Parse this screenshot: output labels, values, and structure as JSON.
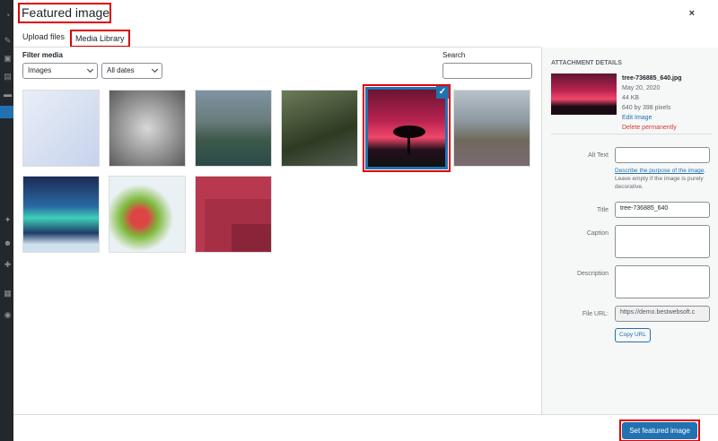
{
  "modal": {
    "title": "Featured image",
    "close_label": "×"
  },
  "tabs": [
    {
      "label": "Upload files"
    },
    {
      "label": "Media Library"
    }
  ],
  "filters": {
    "filter_label": "Filter media",
    "type_select": "Images",
    "date_select": "All dates",
    "search_label": "Search",
    "search_value": ""
  },
  "attachment": {
    "heading": "ATTACHMENT DETAILS",
    "filename": "tree-736885_640.jpg",
    "date": "May 20, 2020",
    "size": "44 KB",
    "dimensions": "640 by 398 pixels",
    "edit_link": "Edit Image",
    "delete_link": "Delete permanently",
    "alt_text_label": "Alt Text",
    "alt_text_value": "",
    "help_link": "Describe the purpose of the image",
    "help_rest": ". Leave empty if the image is purely decorative.",
    "title_label": "Title",
    "title_value": "tree-736885_640",
    "caption_label": "Caption",
    "caption_value": "",
    "description_label": "Description",
    "description_value": "",
    "file_url_label": "File URL:",
    "file_url_value": "https://demo.bestwebsoft.c",
    "copy_button": "Copy URL"
  },
  "footer": {
    "set_button": "Set featured image"
  },
  "colors": {
    "accent": "#2271b1",
    "highlight": "#dd0000",
    "delete": "#d63638"
  }
}
